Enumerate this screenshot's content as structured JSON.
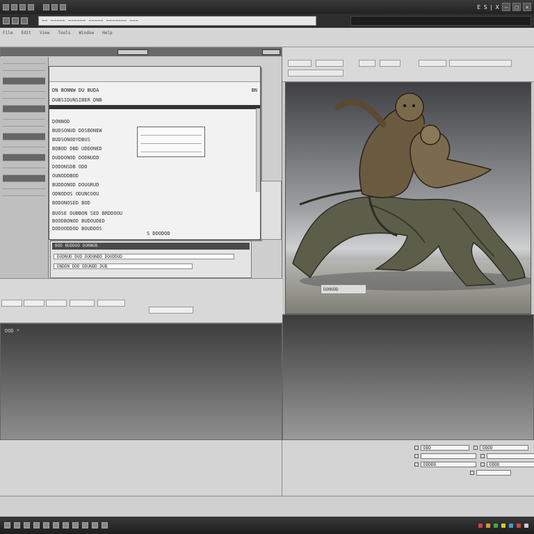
{
  "titlebar": {
    "title": "E S | X",
    "window_buttons": [
      "–",
      "□",
      "×"
    ]
  },
  "toolbar": {
    "address_text": "~~ ~~~~~ ~~~~~~ ~~~~~ ~~~~~~~ ~~~"
  },
  "menu": [
    "File",
    "Edit",
    "View",
    "Tools",
    "Window",
    "Help"
  ],
  "dialog": {
    "title": "DN BONNW DU BUDA",
    "close_label": "BN",
    "lines": [
      "DN BONNW DU BUDA",
      "DUBSIDUNSIBER DNB",
      "DONNOD",
      "BUDSONUD DDSBONEW",
      "BUDSONODYDBUS",
      "BOBOD DBD UDDONED",
      "DUDDONOD DODNUDD",
      "DODONSDB ODD",
      "OUNODDBOD",
      "BUDDONOD DOUGRUD",
      "ODNODOS ODUNCOOU",
      "BODONOSED BOD",
      "BUOSE DUBBON SED BRDDOOU",
      "BOODBONOD BUDOUDED",
      "DODOODDOD BOUDDOS"
    ],
    "ok_label": "S DOODOD"
  },
  "form_strip": {
    "header": "BOD BUDDOD DONNOB",
    "fields": [
      "DUDNUD DUD DODONDD DOUDDUD",
      "DNDDN DDD DDUNDD DUB"
    ]
  },
  "viewport": {
    "label": "DONUDD"
  },
  "left_panel_label": "DOD *",
  "controls": [
    "DDD",
    "DDDD",
    "DDDDD",
    "DDDD"
  ],
  "colors": {
    "chrome_dark": "#2e2e2e",
    "panel_gray": "#cfcfcf",
    "viewport_top": "#3f4044",
    "viewport_mid": "#cfd0d2",
    "model_fur": "#6a5a40",
    "model_wood": "#5a5c48"
  },
  "tray_colors": [
    "#c44",
    "#d93",
    "#4a4",
    "#cc3",
    "#49c",
    "#c44",
    "#ccc"
  ]
}
